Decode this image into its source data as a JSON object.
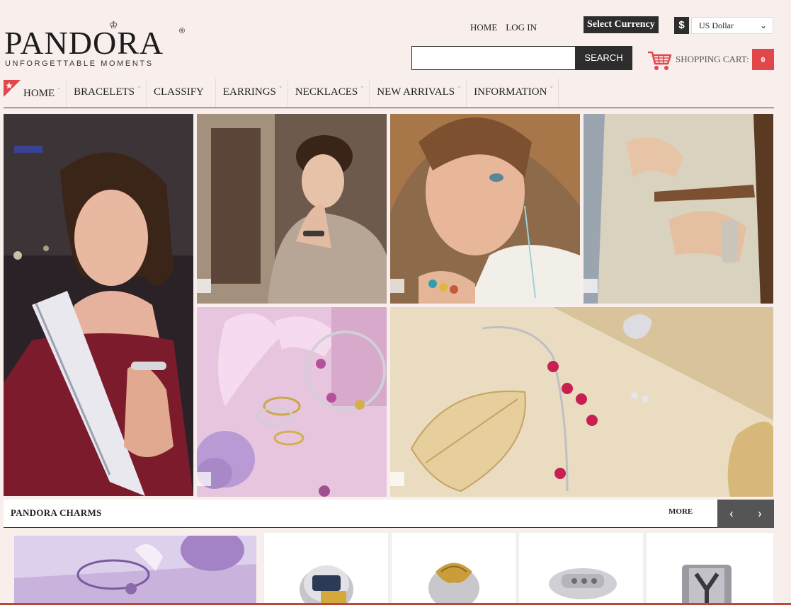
{
  "brand": {
    "name": "PANDORA",
    "registered": "®",
    "tagline": "UNFORGETTABLE MOMENTS"
  },
  "top_links": {
    "home": "HOME",
    "login": "LOG IN"
  },
  "currency": {
    "label": "Select Currency",
    "symbol": "$",
    "selected": "US Dollar"
  },
  "search": {
    "placeholder": "",
    "button": "SEARCH"
  },
  "cart": {
    "label": "SHOPPING CART:",
    "count": "0"
  },
  "nav": {
    "items": [
      "HOME",
      "BRACELETS",
      "CLASSIFY",
      "EARRINGS",
      "NECKLACES",
      "NEW ARRIVALS",
      "INFORMATION"
    ]
  },
  "mosaic": {
    "tiles": [
      {
        "name": "miss-teen-photo"
      },
      {
        "name": "woman-bracelet-photo"
      },
      {
        "name": "woman-earphones-photo"
      },
      {
        "name": "hands-rings-photo"
      },
      {
        "name": "lavender-jewelry-photo"
      },
      {
        "name": "gold-leaf-bracelet-photo"
      }
    ]
  },
  "charms": {
    "title": "PANDORA CHARMS",
    "more": "MORE",
    "prev_icon": "chevron-left-icon",
    "next_icon": "chevron-right-icon"
  },
  "colors": {
    "background": "#f8efed",
    "dark": "#2d2d2d",
    "accent_red": "#e0464a"
  }
}
